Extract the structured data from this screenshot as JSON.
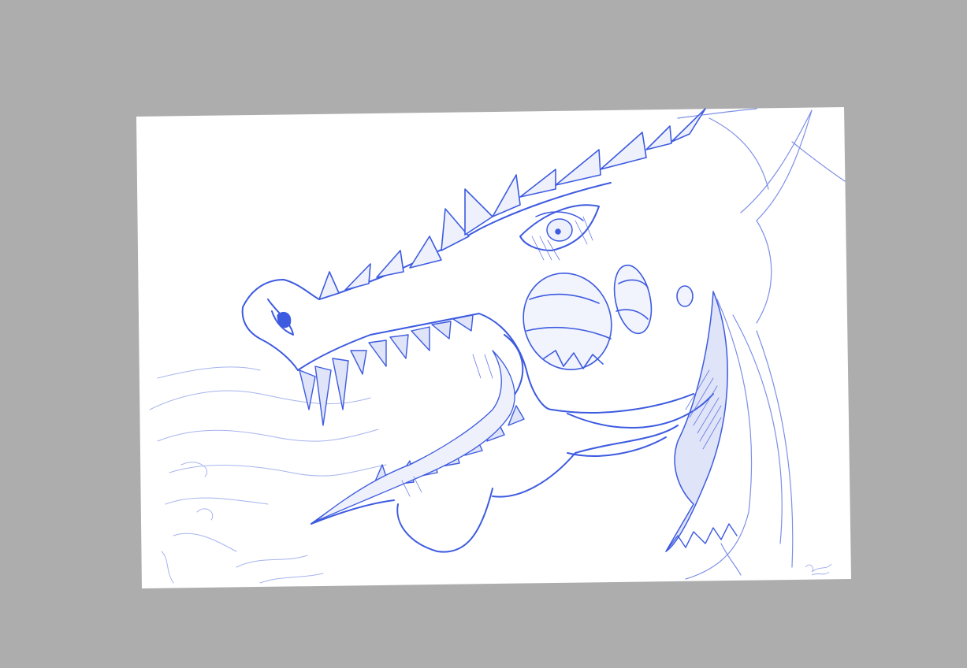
{
  "workspace": {
    "background_color": "#adadad",
    "paper_color": "#ffffff",
    "ink_color": "#3d5be0",
    "ink_light_color": "#9aa9ec"
  },
  "artwork": {
    "subject": "dragon-head-sketch",
    "signature_text": ""
  }
}
